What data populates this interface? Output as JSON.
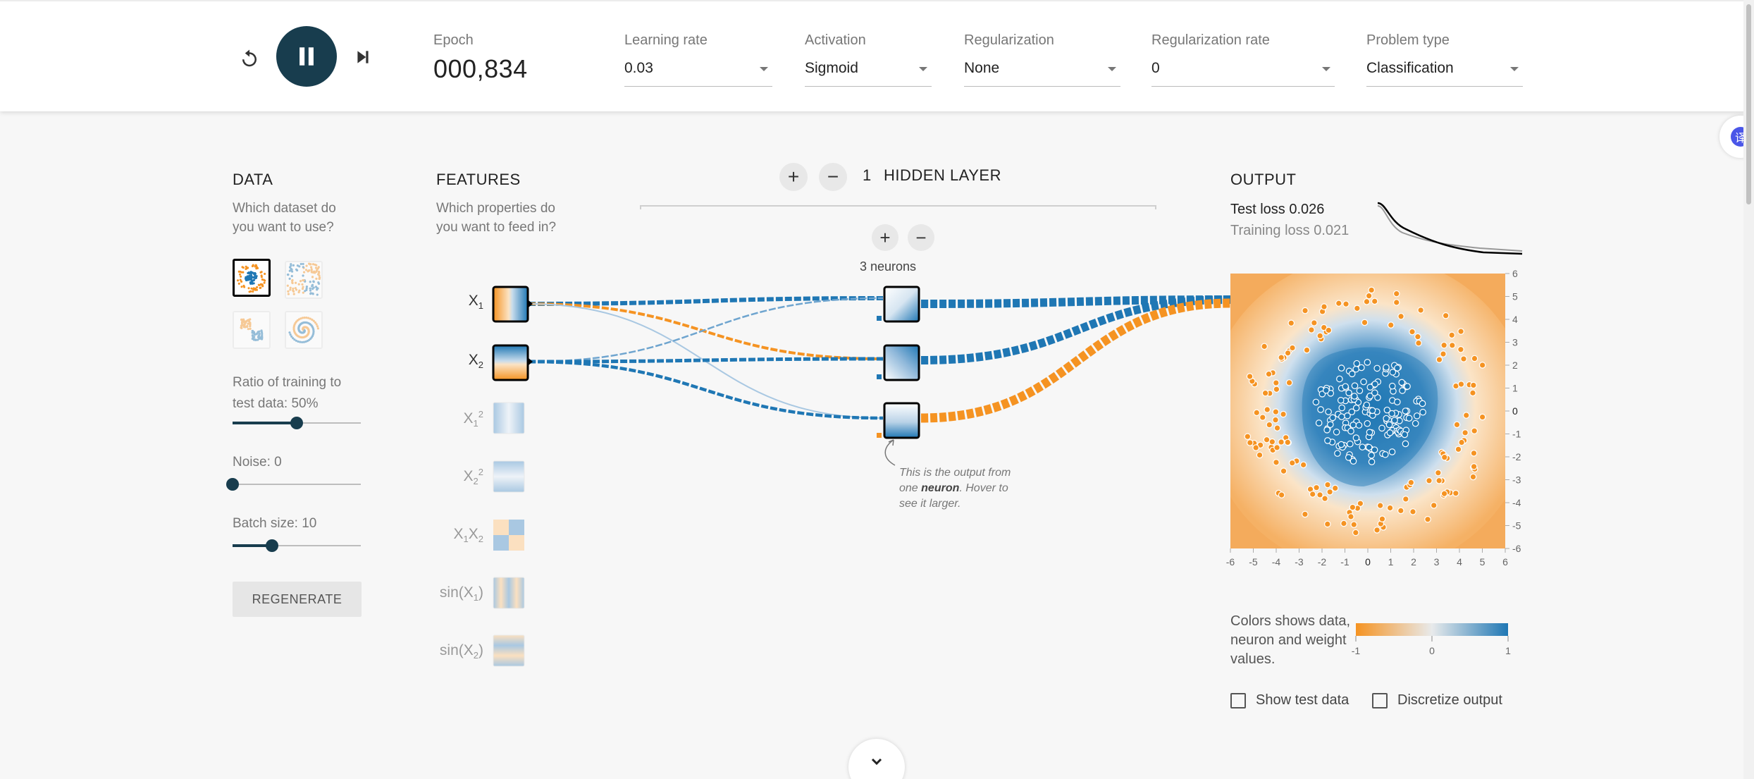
{
  "header": {
    "epoch_label": "Epoch",
    "epoch_value": "000,834",
    "controls": [
      {
        "label": "Learning rate",
        "value": "0.03"
      },
      {
        "label": "Activation",
        "value": "Sigmoid"
      },
      {
        "label": "Regularization",
        "value": "None"
      },
      {
        "label": "Regularization rate",
        "value": "0"
      },
      {
        "label": "Problem type",
        "value": "Classification"
      }
    ]
  },
  "data_panel": {
    "title": "DATA",
    "subtitle_line1": "Which dataset do",
    "subtitle_line2": "you want to use?",
    "datasets": [
      "circle",
      "xor",
      "gaussian",
      "spiral"
    ],
    "selected_dataset": "circle",
    "ratio_label_line1": "Ratio of training to",
    "ratio_label_line2": "test data:  50%",
    "ratio_value": 50,
    "noise_label": "Noise:  0",
    "noise_value": 0,
    "batch_label": "Batch size:  10",
    "batch_value": 10,
    "regenerate_label": "REGENERATE"
  },
  "features_panel": {
    "title": "FEATURES",
    "subtitle_line1": "Which properties do",
    "subtitle_line2": "you want to feed in?"
  },
  "network": {
    "layer_count": "1",
    "layer_label": "HIDDEN LAYER",
    "neurons_label": "3 neurons",
    "callout_pre": "This is the output from one ",
    "callout_bold": "neuron",
    "callout_post": ". Hover to see it larger."
  },
  "output_panel": {
    "title": "OUTPUT",
    "test_loss": "Test loss 0.026",
    "training_loss": "Training loss 0.021",
    "x_ticks": [
      "-6",
      "-5",
      "-4",
      "-3",
      "-2",
      "-1",
      "0",
      "1",
      "2",
      "3",
      "4",
      "5",
      "6"
    ],
    "y_ticks": [
      "6",
      "5",
      "4",
      "3",
      "2",
      "1",
      "0",
      "-1",
      "-2",
      "-3",
      "-4",
      "-5",
      "-6"
    ],
    "legend_text": "Colors shows data, neuron and weight values.",
    "legend_ticks": [
      "-1",
      "0",
      "1"
    ],
    "show_test_data_label": "Show test data",
    "discretize_label": "Discretize output"
  },
  "colors": {
    "positive": "#1f77b4",
    "negative": "#f59322",
    "accent": "#183d4e"
  },
  "translate_icon_text": "译"
}
